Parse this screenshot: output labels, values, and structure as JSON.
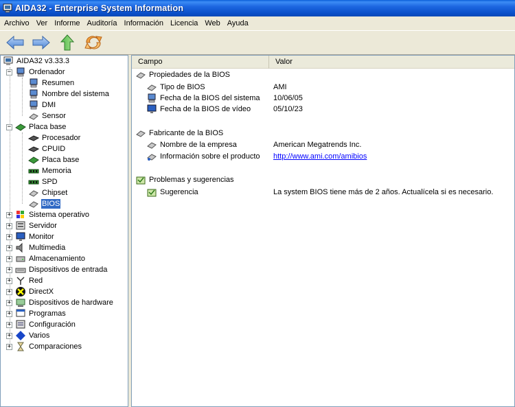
{
  "window": {
    "title": "AIDA32 - Enterprise System Information",
    "icon": "aida-computer-icon"
  },
  "menu": [
    "Archivo",
    "Ver",
    "Informe",
    "Auditoría",
    "Información",
    "Licencia",
    "Web",
    "Ayuda"
  ],
  "toolbar": {
    "back_icon": "back-arrow-icon",
    "forward_icon": "forward-arrow-icon",
    "up_icon": "up-arrow-icon",
    "refresh_icon": "refresh-icon"
  },
  "tree": {
    "root": "AIDA32 v3.33.3",
    "ordenador": {
      "label": "Ordenador",
      "children": [
        "Resumen",
        "Nombre del sistema",
        "DMI",
        "Sensor"
      ]
    },
    "placa_base": {
      "label": "Placa base",
      "children": [
        "Procesador",
        "CPUID",
        "Placa base",
        "Memoria",
        "SPD",
        "Chipset",
        "BIOS"
      ]
    },
    "collapsed": [
      "Sistema operativo",
      "Servidor",
      "Monitor",
      "Multimedia",
      "Almacenamiento",
      "Dispositivos de entrada",
      "Red",
      "DirectX",
      "Dispositivos de hardware",
      "Programas",
      "Configuración",
      "Varios",
      "Comparaciones"
    ]
  },
  "list": {
    "columns": {
      "campo": "Campo",
      "valor": "Valor"
    },
    "groups": [
      {
        "title": "Propiedades de la BIOS",
        "rows": [
          {
            "field": "Tipo de BIOS",
            "value": "AMI"
          },
          {
            "field": "Fecha de la BIOS del sistema",
            "value": "10/06/05"
          },
          {
            "field": "Fecha de la BIOS de vídeo",
            "value": "05/10/23"
          }
        ]
      },
      {
        "title": "Fabricante de la BIOS",
        "rows": [
          {
            "field": "Nombre de la empresa",
            "value": "American Megatrends Inc."
          },
          {
            "field": "Información sobre el producto",
            "value": "http://www.ami.com/amibios"
          }
        ]
      },
      {
        "title": "Problemas y sugerencias",
        "rows": [
          {
            "field": "Sugerencia",
            "value": "La system BIOS tiene más de 2 años. Actualícela si es necesario."
          }
        ]
      }
    ]
  },
  "colors": {
    "titlebar": "#0a4fc9",
    "selection": "#316ac5",
    "link": "#0000ff",
    "window_bg": "#ece9d8"
  }
}
